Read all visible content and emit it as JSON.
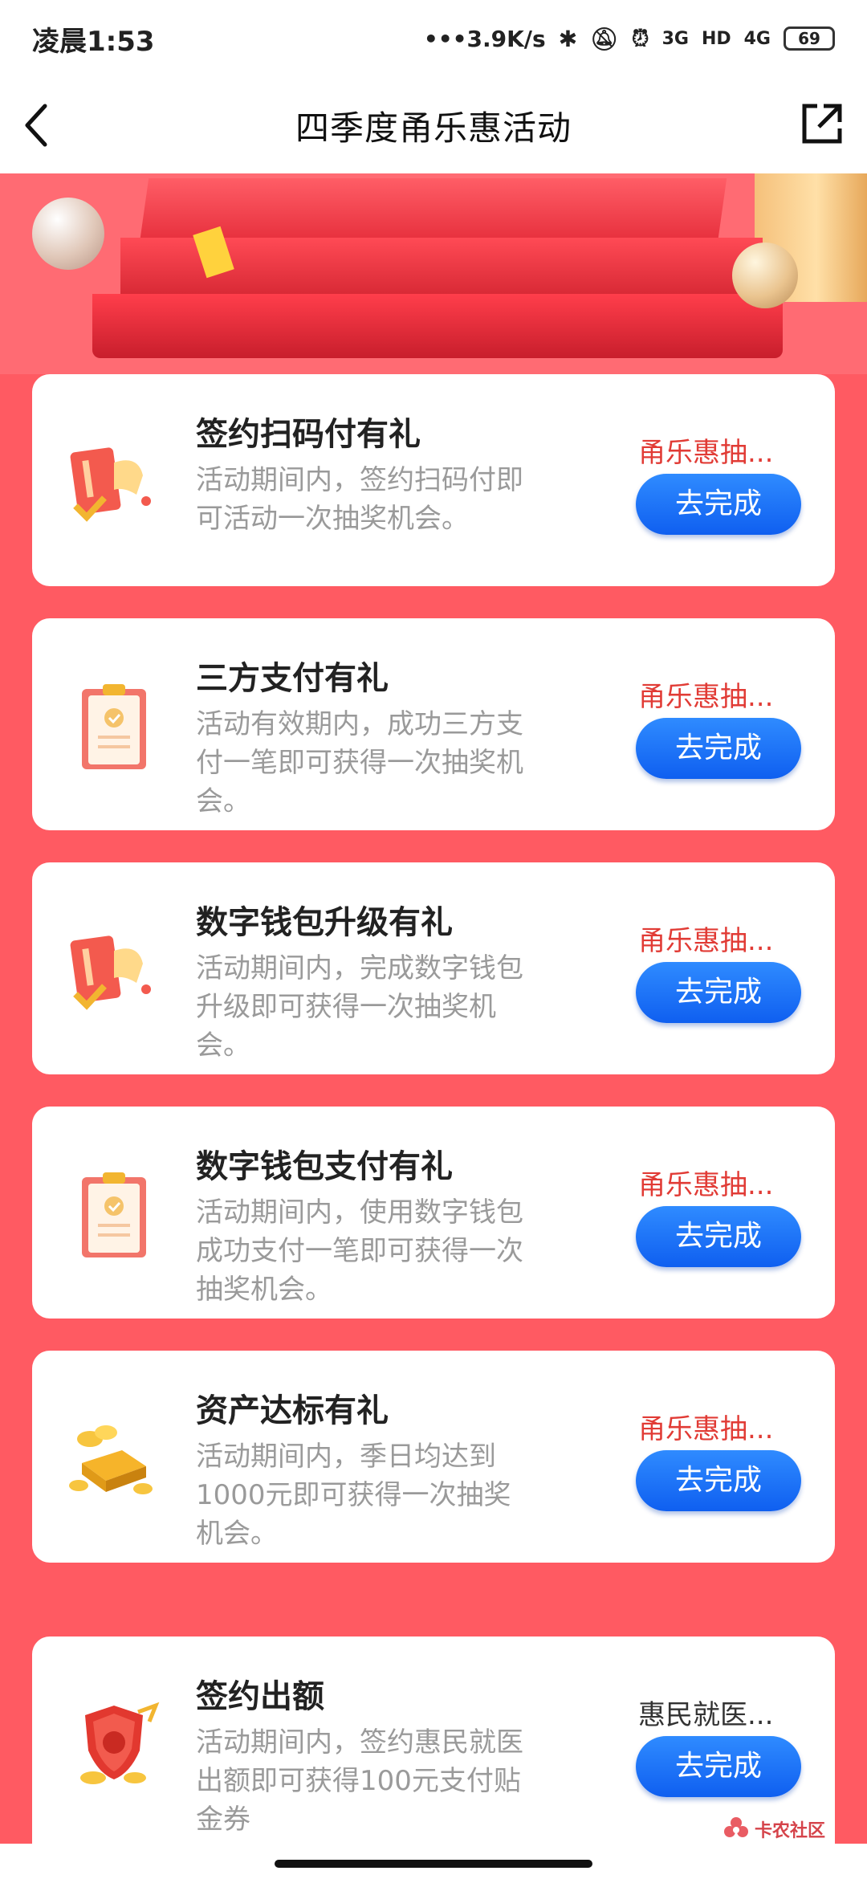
{
  "status_bar": {
    "time": "凌晨1:53",
    "speed": "•••3.9K/s",
    "net1": "3G",
    "hd": "HD",
    "net2": "4G",
    "battery": "69"
  },
  "header": {
    "title": "四季度甬乐惠活动",
    "back_icon": "chevron-left-icon",
    "share_icon": "external-link-icon"
  },
  "tasks": [
    {
      "title": "签约扫码付有礼",
      "desc": "活动期间内，签约扫码付即可活动一次抽奖机会。",
      "tag": "甬乐惠抽...",
      "button": "去完成",
      "icon": "card-check-icon"
    },
    {
      "title": "三方支付有礼",
      "desc": "活动有效期内，成功三方支付一笔即可获得一次抽奖机会。",
      "tag": "甬乐惠抽...",
      "button": "去完成",
      "icon": "clipboard-check-icon"
    },
    {
      "title": "数字钱包升级有礼",
      "desc": "活动期间内，完成数字钱包升级即可获得一次抽奖机会。",
      "tag": "甬乐惠抽...",
      "button": "去完成",
      "icon": "card-check-icon"
    },
    {
      "title": "数字钱包支付有礼",
      "desc": "活动期间内，使用数字钱包成功支付一笔即可获得一次抽奖机会。",
      "tag": "甬乐惠抽...",
      "button": "去完成",
      "icon": "clipboard-check-icon"
    },
    {
      "title": "资产达标有礼",
      "desc": "活动期间内，季日均达到1000元即可获得一次抽奖机会。",
      "tag": "甬乐惠抽...",
      "button": "去完成",
      "icon": "gold-coins-icon"
    },
    {
      "title": "签约出额",
      "desc": "活动期间内，签约惠民就医出额即可获得100元支付贴金券",
      "tag": "惠民就医...",
      "button": "去完成",
      "icon": "shield-coins-icon"
    }
  ],
  "watermark": {
    "text": "卡农社区"
  },
  "colors": {
    "background": "#ff5a62",
    "button": "#1a6ef5",
    "tag_red": "#e13b35"
  }
}
